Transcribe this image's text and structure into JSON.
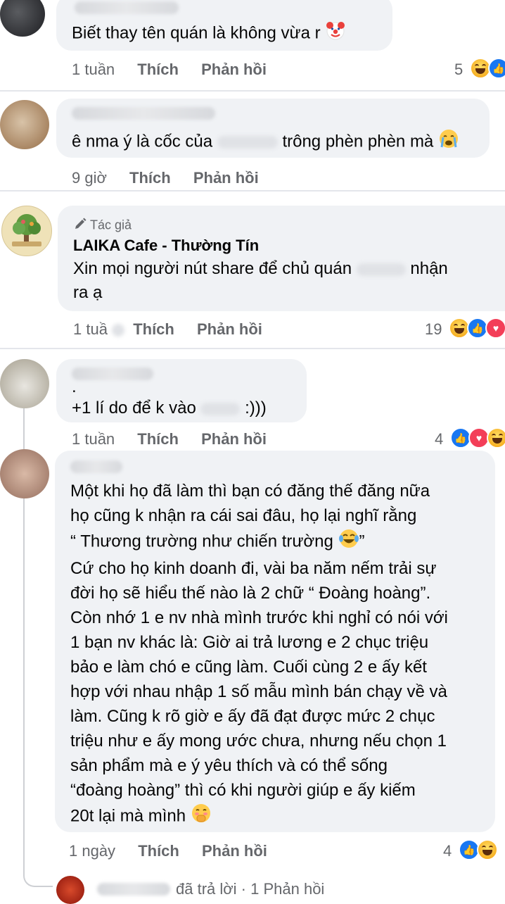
{
  "comments": [
    {
      "text": "Biết thay tên quán là không vừa r",
      "time": "1 tuần",
      "like": "Thích",
      "reply": "Phản hồi",
      "reaction_count": "5"
    },
    {
      "text_before": "ê nma ý là cốc của",
      "text_after": "trông phèn phèn mà",
      "time": "9 giờ",
      "like": "Thích",
      "reply": "Phản hồi"
    },
    {
      "author_badge": "Tác giả",
      "author": "LAIKA Cafe - Thường Tín",
      "line1_before": "Xin mọi người nút share để chủ quán",
      "line1_after": "nhận",
      "line2": "ra ạ",
      "time": "1 tuầ",
      "like": "Thích",
      "reply": "Phản hồi",
      "reaction_count": "19"
    },
    {
      "line0": ".",
      "text_before": "+1 lí do để k vào",
      "text_after": ":)))",
      "time": "1 tuần",
      "like": "Thích",
      "reply": "Phản hồi",
      "reaction_count": "4"
    },
    {
      "lines": [
        "Một khi họ đã làm thì bạn có đăng thế đăng nữa",
        "họ cũng k nhận ra cái sai đâu, họ lại nghĩ rằng",
        "“ Thương trường như chiến trường",
        "Cứ cho họ kinh doanh đi, vài ba năm nếm trải sự",
        "đời họ sẽ hiểu thế nào là 2 chữ “ Đoàng hoàng”.",
        "Còn nhớ 1 e nv nhà mình trước khi nghỉ có nói với",
        "1 bạn nv khác là: Giờ ai trả lương e 2 chục triệu",
        "bảo e làm chó e cũng làm. Cuối cùng 2 e ấy kết",
        "hợp với nhau nhập 1 số mẫu mình bán chạy về và",
        "làm. Cũng k rõ giờ e ấy đã đạt được mức 2 chục",
        "triệu như e ấy mong ước chưa, nhưng nếu chọn 1",
        "sản phẩm mà e ý yêu thích và có thể sống",
        "“đoàng hoàng” thì có khi người giúp e ấy kiếm",
        "20t lại mà mình"
      ],
      "quote_close": "”",
      "time": "1 ngày",
      "like": "Thích",
      "reply": "Phản hồi",
      "reaction_count": "4"
    }
  ],
  "reply_summary": "đã trả lời · 1 Phản hồi",
  "colors": {
    "bubble": "#f0f2f5",
    "meta": "#65676b",
    "text": "#050505",
    "like_blue": "#1877f2",
    "love_red": "#f33e58",
    "haha_yellow": "#f7b125"
  },
  "icons": [
    "clown-emoji",
    "crying-emoji",
    "pencil-icon",
    "laughing-tears-emoji",
    "hand-over-mouth-emoji",
    "haha-reaction-icon",
    "like-reaction-icon",
    "love-reaction-icon"
  ]
}
